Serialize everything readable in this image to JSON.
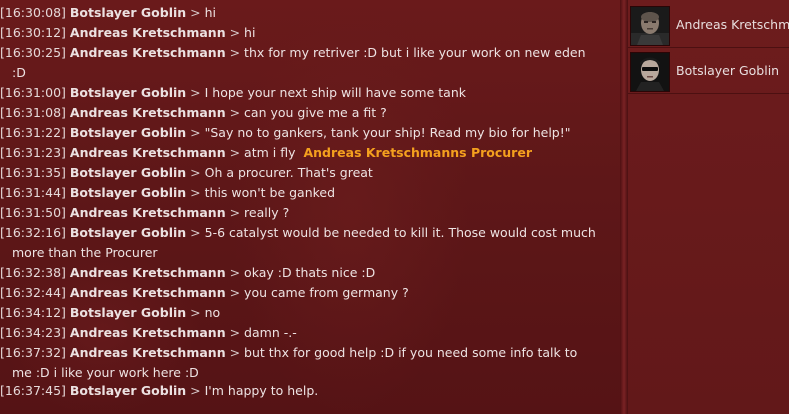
{
  "chat": {
    "messages": [
      {
        "time": "[16:30:08]",
        "name": "Botslayer Goblin",
        "sep": ">",
        "text": "hi"
      },
      {
        "time": "[16:30:12]",
        "name": "Andreas Kretschmann",
        "sep": ">",
        "text": "hi"
      },
      {
        "time": "[16:30:25]",
        "name": "Andreas Kretschmann",
        "sep": ">",
        "text": "thx for my retriver :D but i like your work on new eden",
        "cont": ":D"
      },
      {
        "time": "[16:31:00]",
        "name": "Botslayer Goblin",
        "sep": ">",
        "text": "I hope your next ship will have some tank"
      },
      {
        "time": "[16:31:08]",
        "name": "Andreas Kretschmann",
        "sep": ">",
        "text": "can you give me a fit ?"
      },
      {
        "time": "[16:31:22]",
        "name": "Botslayer Goblin",
        "sep": ">",
        "text": "\"Say no to gankers, tank your ship! Read my bio for help!\""
      },
      {
        "time": "[16:31:23]",
        "name": "Andreas Kretschmann",
        "sep": ">",
        "text": "atm i fly",
        "link": "Andreas Kretschmanns Procurer"
      },
      {
        "time": "[16:31:35]",
        "name": "Botslayer Goblin",
        "sep": ">",
        "text": "Oh a procurer. That's great"
      },
      {
        "time": "[16:31:44]",
        "name": "Botslayer Goblin",
        "sep": ">",
        "text": "this won't be ganked"
      },
      {
        "time": "[16:31:50]",
        "name": "Andreas Kretschmann",
        "sep": ">",
        "text": "really ?"
      },
      {
        "time": "[16:32:16]",
        "name": "Botslayer Goblin",
        "sep": ">",
        "text": "5-6 catalyst would be needed to kill it. Those would cost much",
        "cont": "more than the Procurer"
      },
      {
        "time": "[16:32:38]",
        "name": "Andreas Kretschmann",
        "sep": ">",
        "text": "okay :D thats nice :D"
      },
      {
        "time": "[16:32:44]",
        "name": "Andreas Kretschmann",
        "sep": ">",
        "text": "you came from germany ?"
      },
      {
        "time": "[16:34:12]",
        "name": "Botslayer Goblin",
        "sep": ">",
        "text": "no"
      },
      {
        "time": "[16:34:23]",
        "name": "Andreas Kretschmann",
        "sep": ">",
        "text": "damn -.-"
      },
      {
        "time": "[16:37:32]",
        "name": "Andreas Kretschmann",
        "sep": ">",
        "text": "but thx for good help :D if you need some info talk to",
        "cont": "me :D i like your work here :D"
      },
      {
        "time": "[16:37:45]",
        "name": "Botslayer Goblin",
        "sep": ">",
        "text": "I'm happy to help."
      }
    ]
  },
  "members": [
    {
      "name": "Andreas Kretschmann",
      "avatar": "avatar-andreas"
    },
    {
      "name": "Botslayer Goblin",
      "avatar": "avatar-botslayer"
    }
  ],
  "colors": {
    "background": "#5e1718",
    "link": "#f4a01e",
    "text": "#eee3e3"
  }
}
